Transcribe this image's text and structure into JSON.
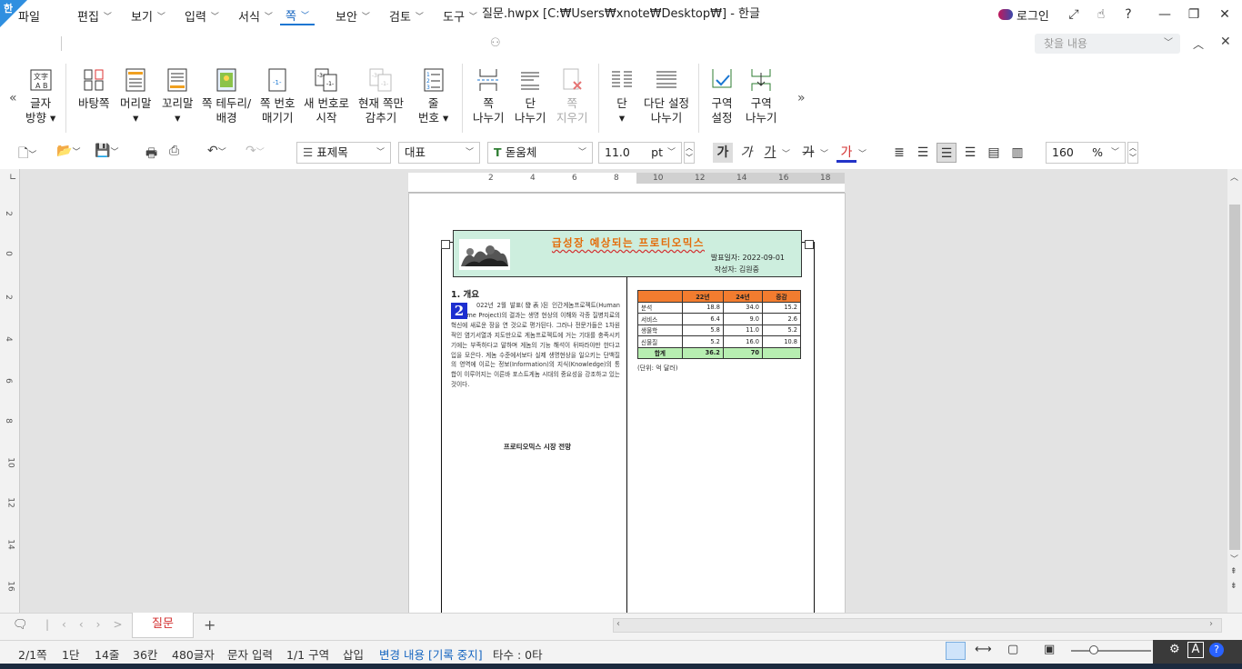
{
  "window": {
    "logo_label": "한",
    "title": "질문.hwpx [C:₩Users₩xnote₩Desktop₩] - 한글",
    "login": "로그인"
  },
  "menu": {
    "items": [
      "파일",
      "편집",
      "보기",
      "입력",
      "서식",
      "쪽",
      "보안",
      "검토",
      "도구"
    ],
    "find_placeholder": "찾을 내용"
  },
  "ribbon": {
    "buttons": [
      {
        "label1": "글자",
        "label2": "방향"
      },
      {
        "label1": "바탕쪽",
        "label2": ""
      },
      {
        "label1": "머리말",
        "label2": ""
      },
      {
        "label1": "꼬리말",
        "label2": ""
      },
      {
        "label1": "쪽 테두리/",
        "label2": "배경"
      },
      {
        "label1": "쪽 번호",
        "label2": "매기기"
      },
      {
        "label1": "새 번호로",
        "label2": "시작"
      },
      {
        "label1": "현재 쪽만",
        "label2": "감추기"
      },
      {
        "label1": "줄",
        "label2": "번호"
      },
      {
        "label1": "쪽",
        "label2": "나누기"
      },
      {
        "label1": "단",
        "label2": "나누기"
      },
      {
        "label1": "쪽",
        "label2": "지우기"
      },
      {
        "label1": "단",
        "label2": ""
      },
      {
        "label1": "다단 설정",
        "label2": "나누기"
      },
      {
        "label1": "구역",
        "label2": "설정"
      },
      {
        "label1": "구역",
        "label2": "나누기"
      }
    ]
  },
  "format": {
    "style": "표제목",
    "font_lang": "대표",
    "font": "돋움체",
    "font_size": "11.0",
    "size_unit": "pt",
    "bold": "가",
    "italic": "가",
    "underline": "가",
    "strike": "가",
    "color": "가",
    "zoom": "160",
    "zoom_unit": "%"
  },
  "ruler": {
    "h_ticks": [
      "2",
      "4",
      "6",
      "8",
      "10",
      "12",
      "14",
      "16",
      "18"
    ],
    "v_ticks": [
      "2",
      "0",
      "2",
      "4",
      "6",
      "8",
      "10",
      "12",
      "14",
      "16"
    ]
  },
  "document": {
    "header_title": "급성장 예상되는 프로티오믹스",
    "issue_date": "발표일자: 2022-09-01",
    "author": "작성자: 김원중",
    "section_heading": "1. 개요",
    "dropcap": "2",
    "body": "022년 2월 발표(發表)된 인간게놈프로젝트(Human Genome Project)의 결과는 생명 현상의 이해와 각종 질병치료의 혁신에 새로운 장을 연 것으로 평가된다. 그러나 전문가들은 1차원적인 염기서열과 지도만으로 게놈프로젝트에 거는 기대를 충족시키기에는 부족하다고 말하며 게놈의 기능 해석이 뒤따라야만 한다고 입을 모은다. 게놈 수준에서보다 실제 생명현상을 일으키는 단백질의 영역에 이르는 정보(Information)의 지식(Knowledge)의 통합이 이루어지는 이른바 포스트게놈 시대의 중요성을 강조하고 있는 것이다.",
    "caption": "프로티오믹스 시장 전망",
    "unit_note": "(단위: 억 달러)",
    "table": {
      "headers": [
        "",
        "22년",
        "24년",
        "증감"
      ],
      "rows": [
        [
          "분석",
          "18.8",
          "34.0",
          "15.2"
        ],
        [
          "서비스",
          "6.4",
          "9.0",
          "2.6"
        ],
        [
          "생물학",
          "5.8",
          "11.0",
          "5.2"
        ],
        [
          "신물질",
          "5.2",
          "16.0",
          "10.8"
        ]
      ],
      "total": [
        "합계",
        "36.2",
        "70",
        ""
      ]
    }
  },
  "tabs": {
    "sheet": "질문"
  },
  "status": {
    "page": "2/1쪽",
    "column": "1단",
    "line": "14줄",
    "col": "36칸",
    "chars": "480글자",
    "mode": "문자 입력",
    "section": "1/1 구역",
    "insert": "삽입",
    "track": "변경 내용 [기록 중지]",
    "keystrokes": "타수 : 0타"
  },
  "colors": {
    "accent": "#1976d2",
    "header_fill": "#cdeede",
    "table_head": "#f27c2f",
    "table_total": "#b7eeb1",
    "title_orange": "#e46c0a"
  }
}
